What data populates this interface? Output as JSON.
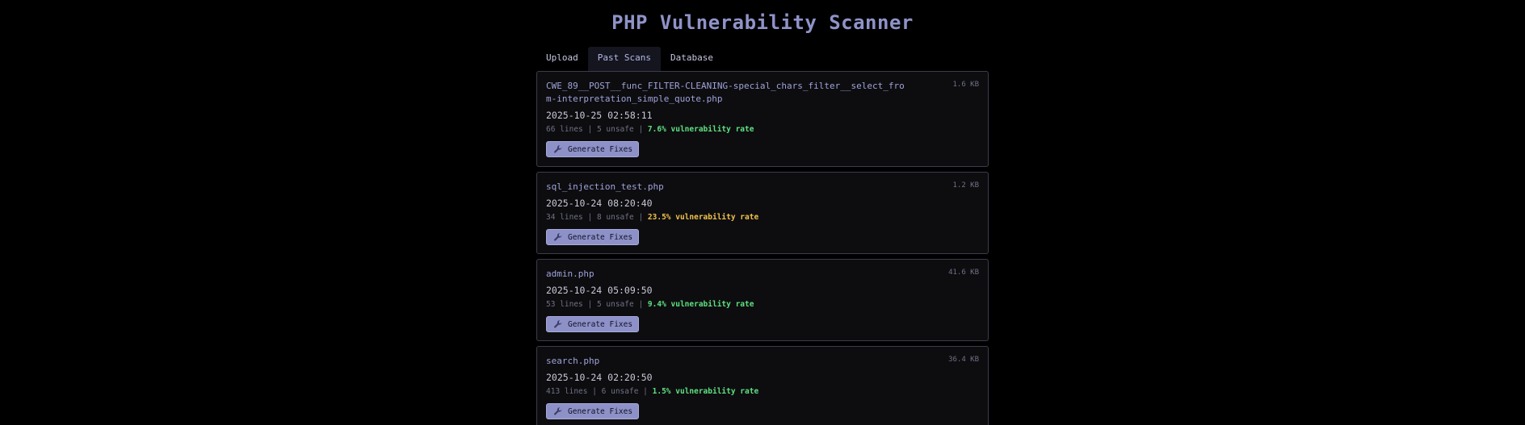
{
  "app": {
    "title": "PHP Vulnerability Scanner"
  },
  "tabs": [
    {
      "label": "Upload",
      "active": false
    },
    {
      "label": "Past Scans",
      "active": true
    },
    {
      "label": "Database",
      "active": false
    }
  ],
  "colors": {
    "accent": "#8d91c8",
    "rate_low": "#5ee07e",
    "rate_mid": "#f0c24a"
  },
  "scans": [
    {
      "filename": "CWE_89__POST__func_FILTER-CLEANING-special_chars_filter__select_from-interpretation_simple_quote.php",
      "size": "1.6 KB",
      "date": "2025-10-25 02:58:11",
      "lines": "66 lines",
      "unsafe": "5 unsafe",
      "rate": "7.6% vulnerability rate",
      "rate_color": "#5ee07e",
      "button_label": "Generate Fixes",
      "button_icon": "wrench-icon"
    },
    {
      "filename": "sql_injection_test.php",
      "size": "1.2 KB",
      "date": "2025-10-24 08:20:40",
      "lines": "34 lines",
      "unsafe": "8 unsafe",
      "rate": "23.5% vulnerability rate",
      "rate_color": "#f0c24a",
      "button_label": "Generate Fixes",
      "button_icon": "wrench-icon"
    },
    {
      "filename": "admin.php",
      "size": "41.6 KB",
      "date": "2025-10-24 05:09:50",
      "lines": "53 lines",
      "unsafe": "5 unsafe",
      "rate": "9.4% vulnerability rate",
      "rate_color": "#5ee07e",
      "button_label": "Generate Fixes",
      "button_icon": "wrench-icon"
    },
    {
      "filename": "search.php",
      "size": "36.4 KB",
      "date": "2025-10-24 02:20:50",
      "lines": "413 lines",
      "unsafe": "6 unsafe",
      "rate": "1.5% vulnerability rate",
      "rate_color": "#5ee07e",
      "button_label": "Generate Fixes",
      "button_icon": "wrench-icon"
    }
  ]
}
